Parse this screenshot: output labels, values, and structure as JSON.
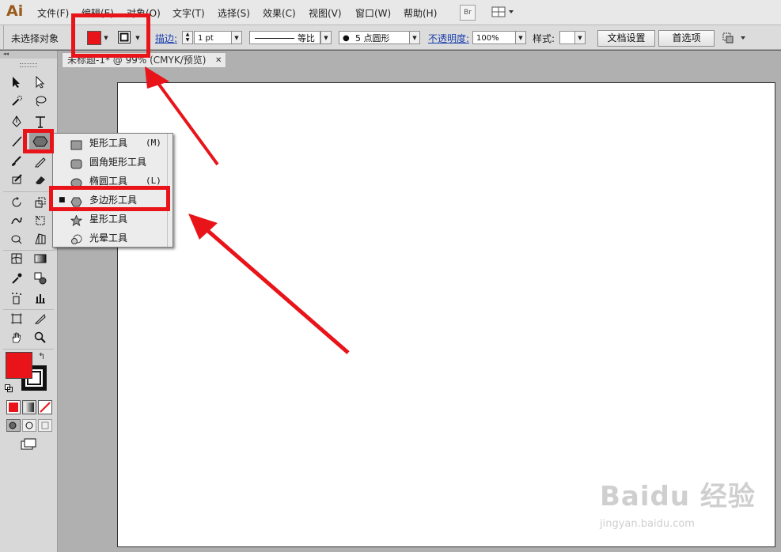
{
  "app": {
    "logo": "Ai"
  },
  "menu": [
    "文件(F)",
    "编辑(E)",
    "对象(O)",
    "文字(T)",
    "选择(S)",
    "效果(C)",
    "视图(V)",
    "窗口(W)",
    "帮助(H)"
  ],
  "menu_icons": {
    "bridge": "Br"
  },
  "control": {
    "selection_status": "未选择对象",
    "fill_color": "#e8141a",
    "stroke_label": "描边:",
    "stroke_weight": "1 pt",
    "stroke_profile": "等比",
    "brush": "5 点圆形",
    "opacity_label": "不透明度:",
    "opacity_value": "100%",
    "style_label": "样式:",
    "doc_setup": "文档设置",
    "preferences": "首选项"
  },
  "document": {
    "tab_title": "未标题-1* @ 99% (CMYK/预览)"
  },
  "flyout": {
    "items": [
      {
        "label": "矩形工具",
        "key": "(M)",
        "icon": "rectangle-icon",
        "active": false
      },
      {
        "label": "圆角矩形工具",
        "key": "",
        "icon": "rounded-rectangle-icon",
        "active": false
      },
      {
        "label": "椭圆工具",
        "key": "(L)",
        "icon": "ellipse-icon",
        "active": false
      },
      {
        "label": "多边形工具",
        "key": "",
        "icon": "polygon-icon",
        "active": true
      },
      {
        "label": "星形工具",
        "key": "",
        "icon": "star-icon",
        "active": false
      },
      {
        "label": "光晕工具",
        "key": "",
        "icon": "flare-icon",
        "active": false
      }
    ]
  },
  "colors": {
    "annotation_red": "#e8141a",
    "fill_red": "#e8141a"
  },
  "watermark": {
    "logo": "Baidu 经验",
    "url": "jingyan.baidu.com"
  }
}
